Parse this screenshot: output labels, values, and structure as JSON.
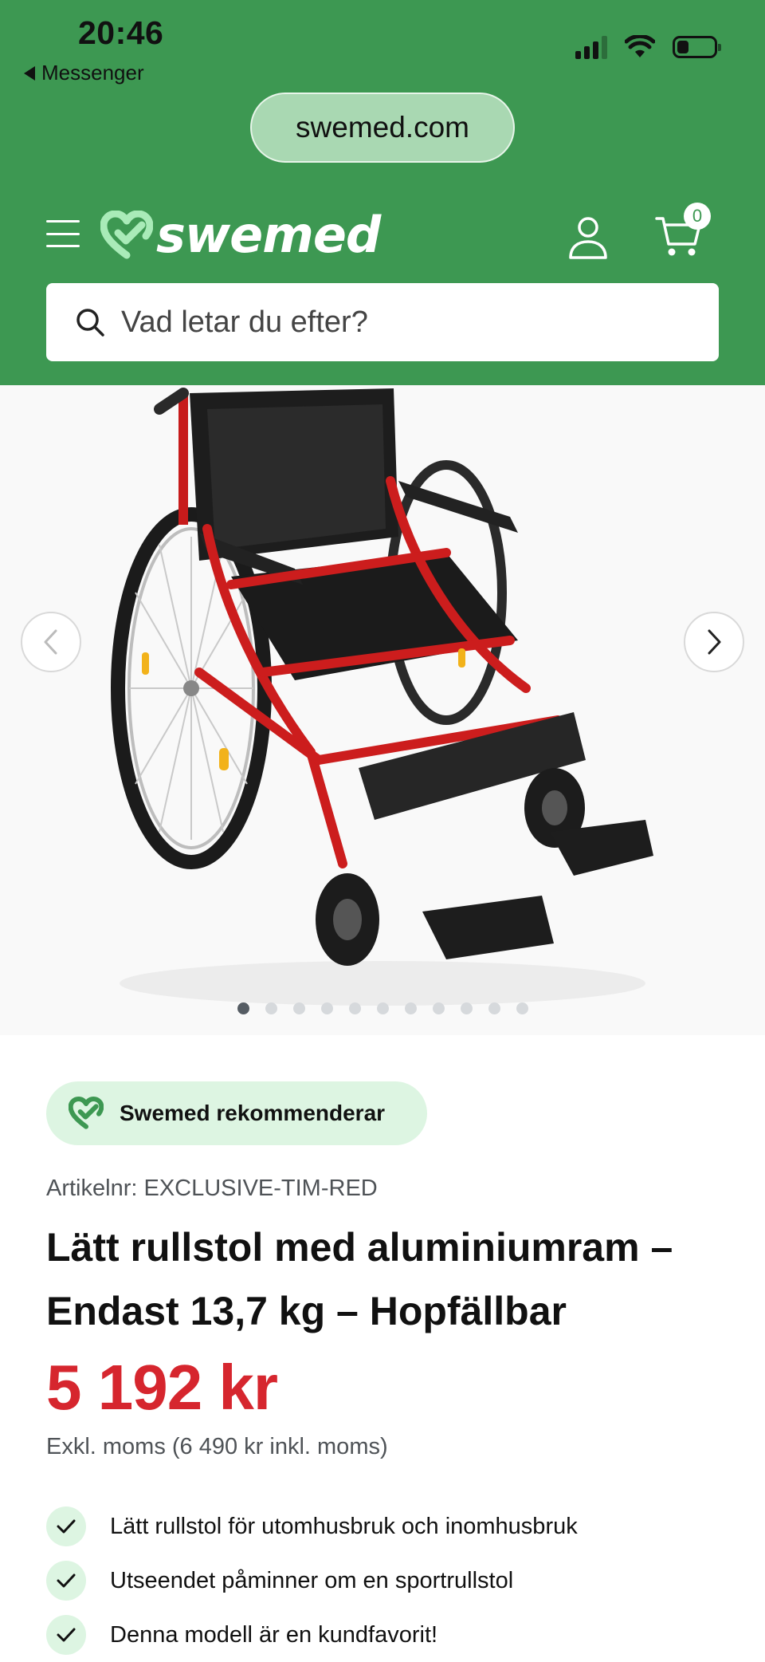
{
  "status_bar": {
    "time": "20:46",
    "back_app": "Messenger"
  },
  "browser": {
    "url": "swemed.com"
  },
  "header": {
    "logo_text": "swemed",
    "cart_count": "0",
    "search_placeholder": "Vad letar du efter?",
    "brand_color": "#3d9852"
  },
  "gallery": {
    "image_count": 11,
    "active_index": 0,
    "image_subject": "red-aluminium-wheelchair"
  },
  "product": {
    "badge": "Swemed rekommenderar",
    "sku": "Artikelnr: EXCLUSIVE-TIM-RED",
    "title": "Lätt rullstol med aluminiumram – Endast 13,7 kg – Hopfällbar",
    "price": "5 192 kr",
    "price_color": "#d6262e",
    "vat_note": "Exkl. moms (6 490 kr inkl. moms)",
    "usps": [
      "Lätt rullstol för utomhusbruk och inomhusbruk",
      "Utseendet påminner om en sportrullstol",
      "Denna modell är en kundfavorit!"
    ]
  }
}
